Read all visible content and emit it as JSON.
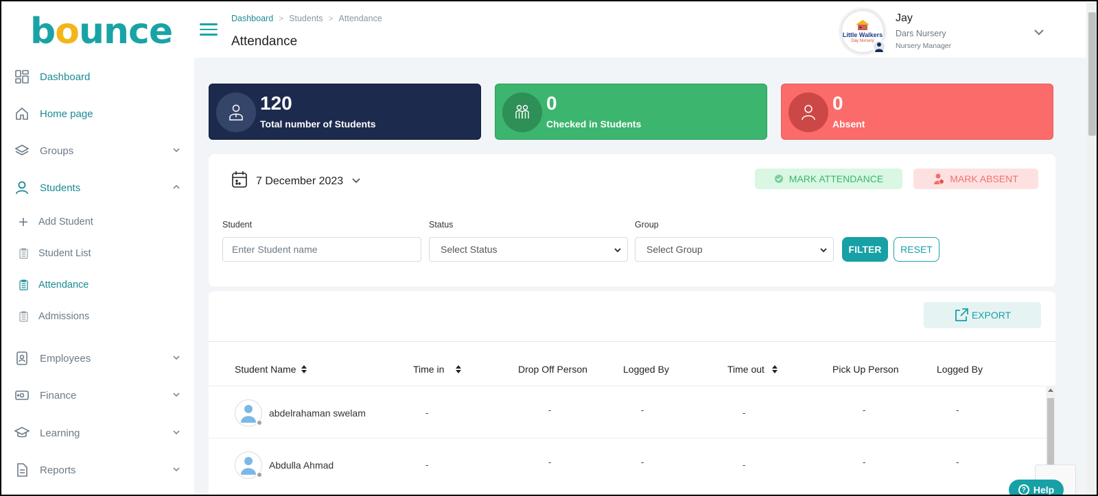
{
  "brand": {
    "logo_pre": "b",
    "logo_o": "o",
    "logo_post": "unce"
  },
  "sidebar": {
    "items": [
      {
        "label": "Dashboard",
        "icon": "dashboard-icon"
      },
      {
        "label": "Home page",
        "icon": "home-icon"
      },
      {
        "label": "Groups",
        "icon": "layers-icon"
      },
      {
        "label": "Students",
        "icon": "user-icon"
      },
      {
        "label": "Employees",
        "icon": "id-badge-icon"
      },
      {
        "label": "Finance",
        "icon": "money-icon"
      },
      {
        "label": "Learning",
        "icon": "graduation-cap-icon"
      },
      {
        "label": "Reports",
        "icon": "document-icon"
      }
    ],
    "students_sub": [
      {
        "label": "Add Student",
        "icon": "plus-icon"
      },
      {
        "label": "Student List",
        "icon": "clipboard-icon"
      },
      {
        "label": "Attendance",
        "icon": "clipboard-icon"
      },
      {
        "label": "Admissions",
        "icon": "clipboard-icon"
      }
    ]
  },
  "header": {
    "breadcrumb": [
      "Dashboard",
      "Students",
      "Attendance"
    ],
    "title": "Attendance"
  },
  "profile": {
    "logo_title": "Little Walkers",
    "logo_sub": "Day Nursery",
    "name": "Jay",
    "org": "Dars Nursery",
    "role": "Nursery Manager"
  },
  "stats": [
    {
      "value": "120",
      "caption": "Total number of Students",
      "color": "#1c2b4d"
    },
    {
      "value": "0",
      "caption": "Checked in Students",
      "color": "#3cb56e"
    },
    {
      "value": "0",
      "caption": "Absent",
      "color": "#fb6b69"
    }
  ],
  "filters": {
    "date": "7 December 2023",
    "mark_attendance": "MARK ATTENDANCE",
    "mark_absent": "MARK ABSENT",
    "student_label": "Student",
    "student_placeholder": "Enter Student name",
    "status_label": "Status",
    "status_value": "Select Status",
    "group_label": "Group",
    "group_value": "Select Group",
    "filter_btn": "FILTER",
    "reset_btn": "RESET"
  },
  "table": {
    "export": "EXPORT",
    "columns": [
      "Student Name",
      "Time in",
      "Drop Off Person",
      "Logged By",
      "Time out",
      "Pick Up Person",
      "Logged By"
    ],
    "rows": [
      {
        "name": "abdelrahaman swelam",
        "time_in": "-",
        "drop_off": "-",
        "logged_in_by": "-",
        "time_out": "-",
        "pick_up": "-",
        "logged_out_by": "-"
      },
      {
        "name": "Abdulla Ahmad",
        "time_in": "-",
        "drop_off": "-",
        "logged_in_by": "-",
        "time_out": "-",
        "pick_up": "-",
        "logged_out_by": "-"
      }
    ]
  },
  "help": "Help",
  "colors": {
    "accent": "#17a0a6",
    "navy": "#1c2b4d",
    "green": "#3cb56e",
    "red": "#fb6b69"
  }
}
